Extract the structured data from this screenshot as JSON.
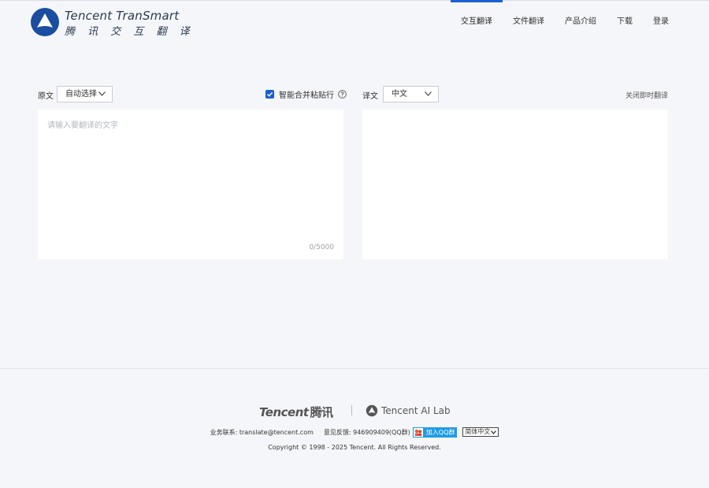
{
  "brand": {
    "name_en": "Tencent TranSmart",
    "name_cn": "腾 讯 交 互 翻 译",
    "accent": "#1b5fd2",
    "logo_color": "#1a4ea0"
  },
  "nav": {
    "items": [
      {
        "label": "交互翻译",
        "active": true
      },
      {
        "label": "文件翻译"
      },
      {
        "label": "产品介绍"
      },
      {
        "label": "下载"
      },
      {
        "label": "登录"
      }
    ]
  },
  "source": {
    "label": "原文",
    "language": "自动选择",
    "placeholder": "请输入要翻译的文字",
    "counter": "0/5000"
  },
  "merge_option": {
    "label": "智能合并粘贴行",
    "checked": true
  },
  "target": {
    "label": "译文",
    "language": "中文",
    "close_instant": "关闭即时翻译"
  },
  "footer": {
    "tencent_logo_en": "Tencent",
    "tencent_logo_cn": "腾讯",
    "ailab": "Tencent AI Lab",
    "business_contact": "业务联系: translate@tencent.com",
    "feedback": "意见反馈: 946909409(QQ群)",
    "qq_button": "加入QQ群",
    "language_select": "简体中文",
    "copyright": "Copyright © 1998 - 2025 Tencent. All Rights Reserved."
  }
}
